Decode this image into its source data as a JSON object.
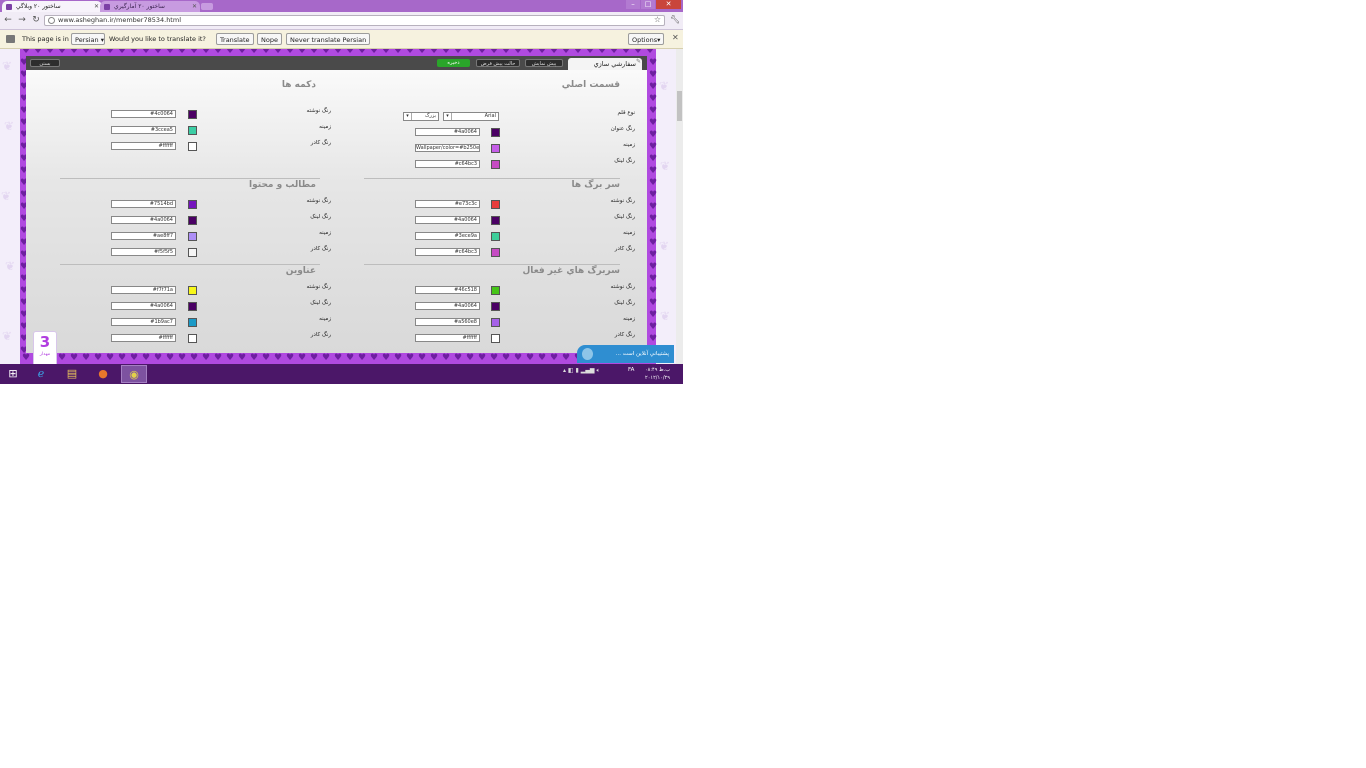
{
  "browser": {
    "tabs": [
      {
        "title": "ﺳﺎﺧﺘﻮﺭ ۲۰ ﻭﺑﻼﮔﻲ"
      },
      {
        "title": "ﺳﺎﺧﺘﻮﺭ ۲۰ ﺁﻣﺎﺭﮔﻴﺮﻱ"
      }
    ],
    "url": "www.asheghan.ir/member78534.html",
    "window_buttons": {
      "minimize": "–",
      "maximize": "□",
      "close": "✕"
    }
  },
  "translate_bar": {
    "prefix": "This page is in",
    "language": "Persian",
    "question": "Would you like to translate it?",
    "translate_button": "Translate",
    "nope_button": "Nope",
    "never_button": "Never translate Persian",
    "options_button": "Options"
  },
  "panel": {
    "active_tab": "ﺳﻔﺎﺭﺷﻲ ﺳﺎﺯﻱ",
    "buttons": {
      "close": "ﺑﺴﺘﻦ",
      "save": "ﺫﺧﻴﺮﻩ",
      "default": "ﺣﺎﻟﺖ ﭘﻴﺶ ﻓﺮﺽ",
      "preview": "ﭘﻴﺶ ﻧﻤﺎﻳﺶ"
    },
    "sections": {
      "main": {
        "title": "ﻗﺴﻤﺖ ﺍﺻﻠﻲ",
        "font_label": "ﻧﻮﻉ ﻗﻠﻢ",
        "font_value": "Arial",
        "size_value": "ﺑﺰﺭگ",
        "rows": [
          {
            "label": "ﺭﻧﮓ ﻋﻨﻮﺍﻥ",
            "value": "#4a0064",
            "color": "#4a0064"
          },
          {
            "label": "ﺯﻣﻴﻨﻪ",
            "value": "Wallpaper/color=#b250e0",
            "color": "#c55ee8"
          },
          {
            "label": "ﺭﻧﮓ ﻟﻴﻨﮏ",
            "value": "#c64bc3",
            "color": "#c64bc3"
          }
        ]
      },
      "buttons_sec": {
        "title": "ﺩﻛﻤﻪ ﻫﺎ",
        "rows": [
          {
            "label": "ﺭﻧﮓ ﻧﻮﺷﺘﻪ",
            "value": "#4c0064",
            "color": "#4c0064"
          },
          {
            "label": "ﺯﻣﻴﻨﻪ",
            "value": "#3ccea5",
            "color": "#3ccea5"
          },
          {
            "label": "ﺭﻧﮓ ﻛﺎﺩﺭ",
            "value": "#ffffff",
            "color": "#ffffff"
          }
        ]
      },
      "headers": {
        "title": "ﺳﺮ ﺑﺮﮒ ﻫﺎ",
        "rows": [
          {
            "label": "ﺭﻧﮓ ﻧﻮﺷﺘﻪ",
            "value": "#e73c3c",
            "color": "#e73c3c"
          },
          {
            "label": "ﺭﻧﮓ ﻟﻴﻨﮏ",
            "value": "#4a0064",
            "color": "#4a0064"
          },
          {
            "label": "ﺯﻣﻴﻨﻪ",
            "value": "#3ece9a",
            "color": "#3ece9a"
          },
          {
            "label": "ﺭﻧﮓ ﻛﺎﺩﺭ",
            "value": "#c64bc3",
            "color": "#c64bc3"
          }
        ]
      },
      "content": {
        "title": "ﻣﻄﺎﻟﺐ ﻭ ﻣﺤﺘﻮﺍ",
        "rows": [
          {
            "label": "ﺭﻧﮓ ﻧﻮﺷﺘﻪ",
            "value": "#7514bd",
            "color": "#7514bd"
          },
          {
            "label": "ﺭﻧﮓ ﻟﻴﻨﮏ",
            "value": "#4a0064",
            "color": "#4a0064"
          },
          {
            "label": "ﺯﻣﻴﻨﻪ",
            "value": "#ae8ff7",
            "color": "#ae8ff7"
          },
          {
            "label": "ﺭﻧﮓ ﻛﺎﺩﺭ",
            "value": "#f5f5f5",
            "color": "#f5f5f5"
          }
        ]
      },
      "inactive_headers": {
        "title": "ﺳﺮﺑﺮﮒ ﻫﺎﻱ ﻏﻴﺮ ﻓﻌﺎﻝ",
        "rows": [
          {
            "label": "ﺭﻧﮓ ﻧﻮﺷﺘﻪ",
            "value": "#46c518",
            "color": "#46c518"
          },
          {
            "label": "ﺭﻧﮓ ﻟﻴﻨﮏ",
            "value": "#4a0064",
            "color": "#4a0064"
          },
          {
            "label": "ﺯﻣﻴﻨﻪ",
            "value": "#a560e8",
            "color": "#a560e8"
          },
          {
            "label": "ﺭﻧﮓ ﻛﺎﺩﺭ",
            "value": "#ffffff",
            "color": "#ffffff"
          }
        ]
      },
      "titles": {
        "title": "ﻋﻨﺎﻭﻳﻦ",
        "rows": [
          {
            "label": "ﺭﻧﮓ ﻧﻮﺷﺘﻪ",
            "value": "#f7f71a",
            "color": "#f7f71a"
          },
          {
            "label": "ﺭﻧﮓ ﻟﻴﻨﮏ",
            "value": "#4a0064",
            "color": "#4a0064"
          },
          {
            "label": "ﺯﻣﻴﻨﻪ",
            "value": "#1b9ac7",
            "color": "#1b9ac7"
          },
          {
            "label": "ﺭﻧﮓ ﻛﺎﺩﺭ",
            "value": "#ffffff",
            "color": "#ffffff"
          }
        ]
      }
    }
  },
  "badge": {
    "number": "3",
    "text": "ﻣﻬﺪﺍﺭ"
  },
  "chat": {
    "text": "ﭘﺸﺘﻴﺒﺎﻧﻲ ﺁﻧﻼﻳﻦ ﺍﺳﺖ ..."
  },
  "taskbar": {
    "lang": "FA",
    "time": "۰۸:۴۹ ب.ظ",
    "date": "۲۰۱۲/۱۰/۲۹"
  }
}
